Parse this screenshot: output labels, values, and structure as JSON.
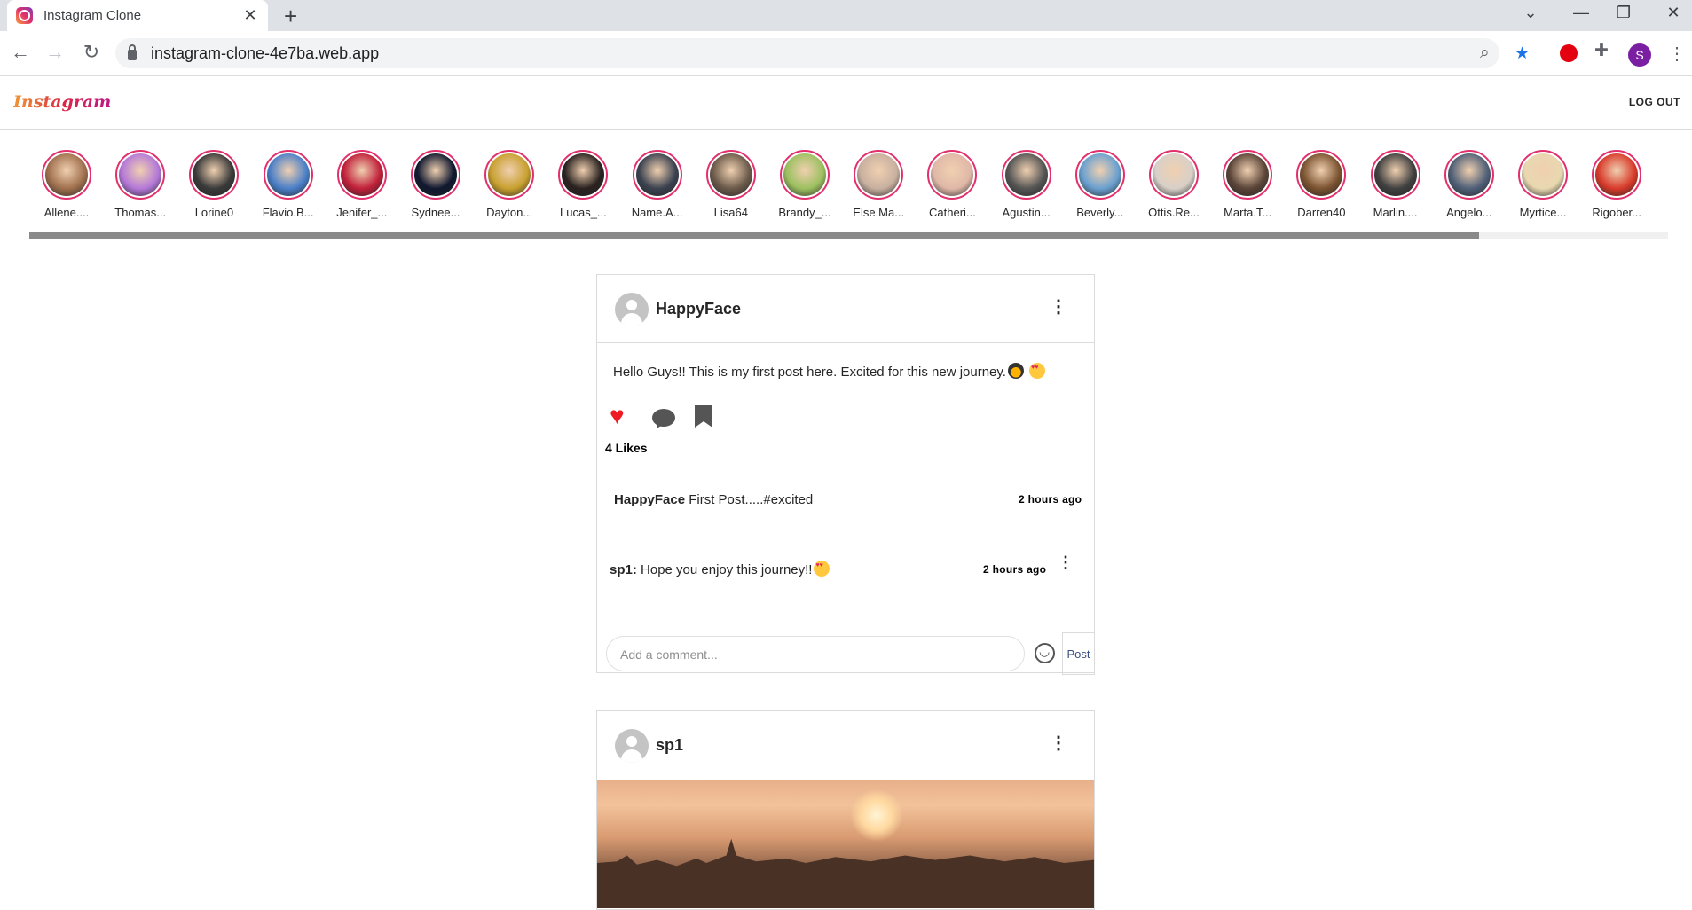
{
  "browser": {
    "tab_title": "Instagram Clone",
    "url": "instagram-clone-4e7ba.web.app",
    "profile_initial": "S"
  },
  "app": {
    "logo": "Instagram",
    "logout_label": "LOG OUT"
  },
  "stories": [
    {
      "name": "Allene....",
      "color": "#a0704e"
    },
    {
      "name": "Thomas...",
      "color": "#b478d8"
    },
    {
      "name": "Lorine0",
      "color": "#3a3a3a"
    },
    {
      "name": "Flavio.B...",
      "color": "#4a7fc8"
    },
    {
      "name": "Jenifer_...",
      "color": "#c0203a"
    },
    {
      "name": "Sydnee...",
      "color": "#101830"
    },
    {
      "name": "Dayton...",
      "color": "#c8a030"
    },
    {
      "name": "Lucas_...",
      "color": "#2a2220"
    },
    {
      "name": "Name.A...",
      "color": "#3b4250"
    },
    {
      "name": "Lisa64",
      "color": "#6b5a4a"
    },
    {
      "name": "Brandy_...",
      "color": "#9cc060"
    },
    {
      "name": "Else.Ma...",
      "color": "#c8b0a0"
    },
    {
      "name": "Catheri...",
      "color": "#e0b8a8"
    },
    {
      "name": "Agustin...",
      "color": "#555555"
    },
    {
      "name": "Beverly...",
      "color": "#6aa0d0"
    },
    {
      "name": "Ottis.Re...",
      "color": "#d8d0c8"
    },
    {
      "name": "Marta.T...",
      "color": "#5a4438"
    },
    {
      "name": "Darren40",
      "color": "#7a5230"
    },
    {
      "name": "Marlin....",
      "color": "#404040"
    },
    {
      "name": "Angelo...",
      "color": "#506078"
    },
    {
      "name": "Myrtice...",
      "color": "#e8d8b0"
    },
    {
      "name": "Rigober...",
      "color": "#d83a2a"
    }
  ],
  "posts": [
    {
      "username": "HappyFace",
      "text": "Hello Guys!! This is my first post here. Excited for this new journey.",
      "likes": "4 Likes",
      "caption_user": "HappyFace",
      "caption_text": "First Post.....#excited",
      "caption_time": "2 hours ago",
      "comment_user": "sp1:",
      "comment_text": "Hope you enjoy this journey!!",
      "comment_time": "2 hours ago",
      "comment_placeholder": "Add a comment...",
      "post_button": "Post"
    },
    {
      "username": "sp1"
    }
  ]
}
